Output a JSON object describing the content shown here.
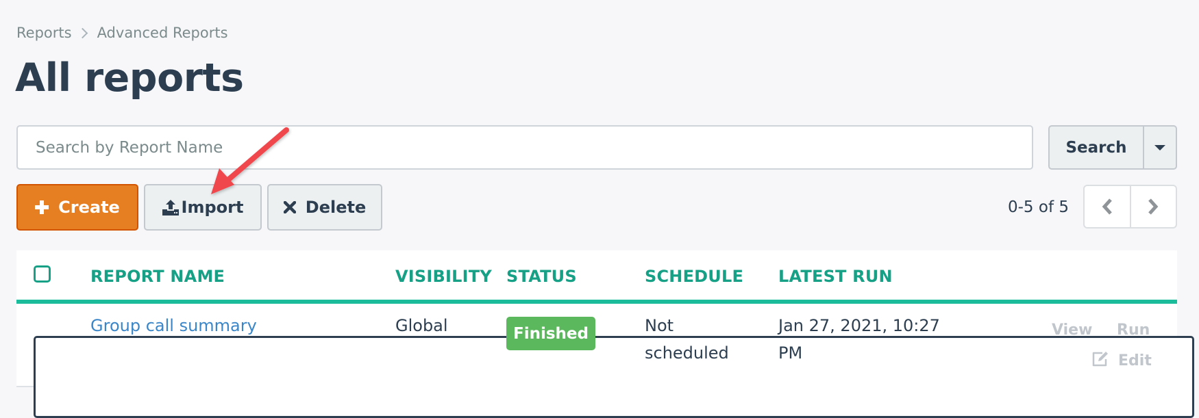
{
  "breadcrumb": {
    "items": [
      "Reports",
      "Advanced Reports"
    ]
  },
  "page": {
    "title": "All reports"
  },
  "search": {
    "placeholder": "Search by Report Name",
    "value": "",
    "button_label": "Search",
    "dropdown_icon": "caret-down-icon"
  },
  "toolbar": {
    "create_label": "Create",
    "create_icon": "plus-icon",
    "import_label": "Import",
    "import_icon": "upload-icon",
    "delete_label": "Delete",
    "delete_icon": "times-icon"
  },
  "pagination": {
    "range_text": "0-5 of 5",
    "prev_icon": "chevron-left-icon",
    "next_icon": "chevron-right-icon"
  },
  "table": {
    "columns": [
      "REPORT NAME",
      "VISIBILITY",
      "STATUS",
      "SCHEDULE",
      "LATEST RUN"
    ],
    "rows": [
      {
        "report_name": "Group call summary",
        "visibility": "Global",
        "status": "Finished",
        "schedule_line1": "Not",
        "schedule_line2": "scheduled",
        "latest_run_line1": "Jan 27, 2021, 10:27",
        "latest_run_line2": "PM",
        "actions": {
          "view": "View",
          "run": "Run",
          "edit": "Edit"
        }
      }
    ]
  },
  "colors": {
    "accent_teal": "#1abc9c",
    "header_text_teal": "#16a085",
    "create_orange": "#e67e22",
    "status_finished_green": "#5cb85c",
    "link_blue": "#3a86c8",
    "annotation_arrow_red": "#f0474d"
  }
}
